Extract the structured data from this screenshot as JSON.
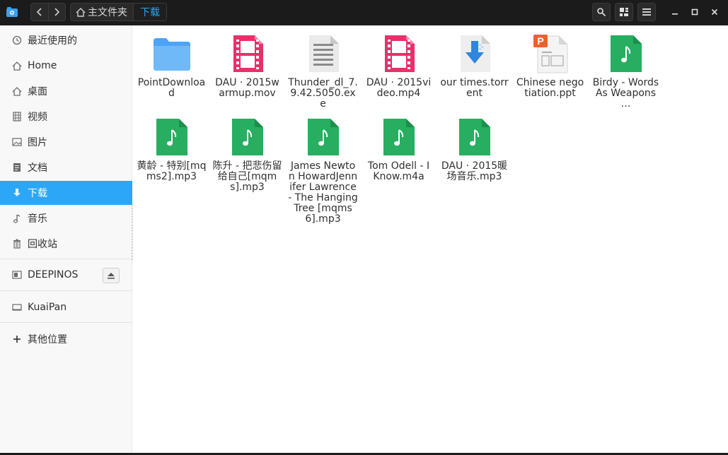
{
  "titlebar": {
    "breadcrumb_home": "主文件夹",
    "breadcrumb_current": "下载"
  },
  "sidebar": {
    "items": [
      {
        "label": "最近使用的",
        "icon": "clock-icon"
      },
      {
        "label": "Home",
        "icon": "home-icon"
      },
      {
        "label": "桌面",
        "icon": "desktop-icon"
      },
      {
        "label": "视频",
        "icon": "video-icon"
      },
      {
        "label": "图片",
        "icon": "picture-icon"
      },
      {
        "label": "文档",
        "icon": "document-icon"
      },
      {
        "label": "下载",
        "icon": "download-icon",
        "active": true
      },
      {
        "label": "音乐",
        "icon": "music-icon"
      },
      {
        "label": "回收站",
        "icon": "trash-icon"
      }
    ],
    "devices": [
      {
        "label": "DEEPINOS",
        "icon": "drive-icon"
      },
      {
        "label": "KuaiPan",
        "icon": "drive-icon"
      }
    ],
    "other_locations": "其他位置"
  },
  "files": [
    {
      "name": "PointDownload",
      "type": "folder"
    },
    {
      "name": "DAU · 2015warmup.mov",
      "type": "video"
    },
    {
      "name": "Thunder_dl_7.9.42.5050.exe",
      "type": "exe"
    },
    {
      "name": "DAU · 2015video.mp4",
      "type": "video"
    },
    {
      "name": "our times.torrent",
      "type": "torrent"
    },
    {
      "name": "Chinese negotiation.ppt",
      "type": "ppt"
    },
    {
      "name": "Birdy - Words As Weapons …",
      "type": "audio"
    },
    {
      "name": "黄龄 - 特别[mqms2].mp3",
      "type": "audio"
    },
    {
      "name": "陈升 - 把悲伤留给自己[mqms].mp3",
      "type": "audio"
    },
    {
      "name": "James Newton HowardJennifer Lawrence - The Hanging Tree [mqms6].mp3",
      "type": "audio"
    },
    {
      "name": "Tom Odell - I Know.m4a",
      "type": "audio"
    },
    {
      "name": "DAU · 2015暖场音乐.mp3",
      "type": "audio"
    }
  ],
  "colors": {
    "accent": "#2ca7f8",
    "titlebar_bg": "#1b1b1b",
    "folder": "#4da3f5",
    "video": "#e8306a",
    "audio": "#27ae60",
    "torrent": "#2e86de",
    "ppt": "#e8632a"
  }
}
